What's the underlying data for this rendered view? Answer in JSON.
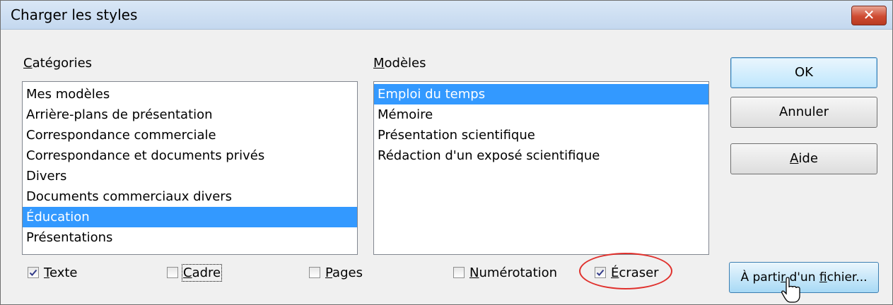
{
  "window": {
    "title": "Charger les styles",
    "close_glyph": "✕"
  },
  "categories": {
    "label_mnemonic": "C",
    "label_rest": "atégories",
    "items": [
      "Mes modèles",
      "Arrière-plans de présentation",
      "Correspondance commerciale",
      "Correspondance et documents privés",
      "Divers",
      "Documents commerciaux divers",
      "Éducation",
      "Présentations"
    ],
    "selected_index": 6
  },
  "templates": {
    "label_mnemonic": "M",
    "label_rest": "odèles",
    "items": [
      "Emploi du temps",
      "Mémoire",
      "Présentation scientifique",
      "Rédaction d'un exposé scientifique"
    ],
    "selected_index": 0
  },
  "buttons": {
    "ok": "OK",
    "cancel": "Annuler",
    "help_mnemonic": "A",
    "help_rest": "ide",
    "from_file_pre": "À parti",
    "from_file_mnemonic": "r",
    "from_file_mid": " d'un ",
    "from_file_mnemonic2": "f",
    "from_file_post": "ichier..."
  },
  "options": {
    "text": {
      "mnemonic": "T",
      "rest": "exte",
      "checked": true
    },
    "frame": {
      "mnemonic": "C",
      "rest": "adre",
      "checked": false
    },
    "pages": {
      "mnemonic": "P",
      "rest": "ages",
      "checked": false
    },
    "numbering": {
      "mnemonic": "N",
      "rest": "umérotation",
      "checked": false
    },
    "overwrite": {
      "mnemonic": "É",
      "rest": "craser",
      "checked": true
    }
  },
  "colors": {
    "selection": "#3399ff",
    "highlight_ring": "#e0312d"
  }
}
